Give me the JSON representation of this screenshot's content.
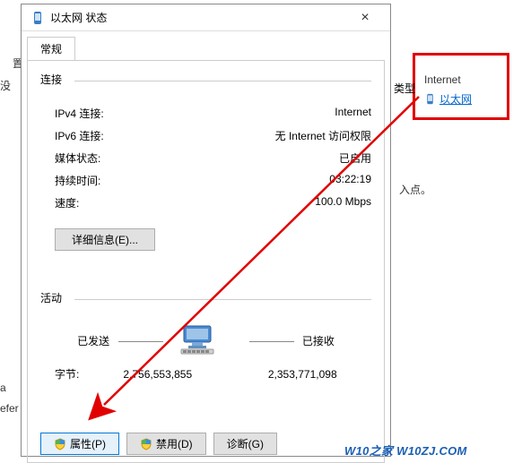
{
  "left_clipped": {
    "t1": "置",
    "t2": "没",
    "t3": "a",
    "t4": "efer"
  },
  "window": {
    "title": "以太网 状态",
    "close": "×",
    "tab": "常规",
    "section_connection": "连接",
    "rows": [
      {
        "label": "IPv4 连接:",
        "value": "Internet"
      },
      {
        "label": "IPv6 连接:",
        "value": "无 Internet 访问权限"
      },
      {
        "label": "媒体状态:",
        "value": "已启用"
      },
      {
        "label": "持续时间:",
        "value": "03:22:19"
      },
      {
        "label": "速度:",
        "value": "100.0 Mbps"
      }
    ],
    "details_btn": "详细信息(E)...",
    "section_activity": "活动",
    "activity": {
      "sent": "已发送",
      "received": "已接收"
    },
    "bytes": {
      "label": "字节:",
      "sent": "2,756,553,855",
      "received": "2,353,771,098"
    },
    "buttons": {
      "properties": "属性(P)",
      "disable": "禁用(D)",
      "diagnose": "诊断(G)"
    }
  },
  "net_box": {
    "header": "类型",
    "title": "Internet",
    "link_text": "以太网"
  },
  "access_point": "入点。",
  "watermark": "W10之家 W10ZJ.COM"
}
